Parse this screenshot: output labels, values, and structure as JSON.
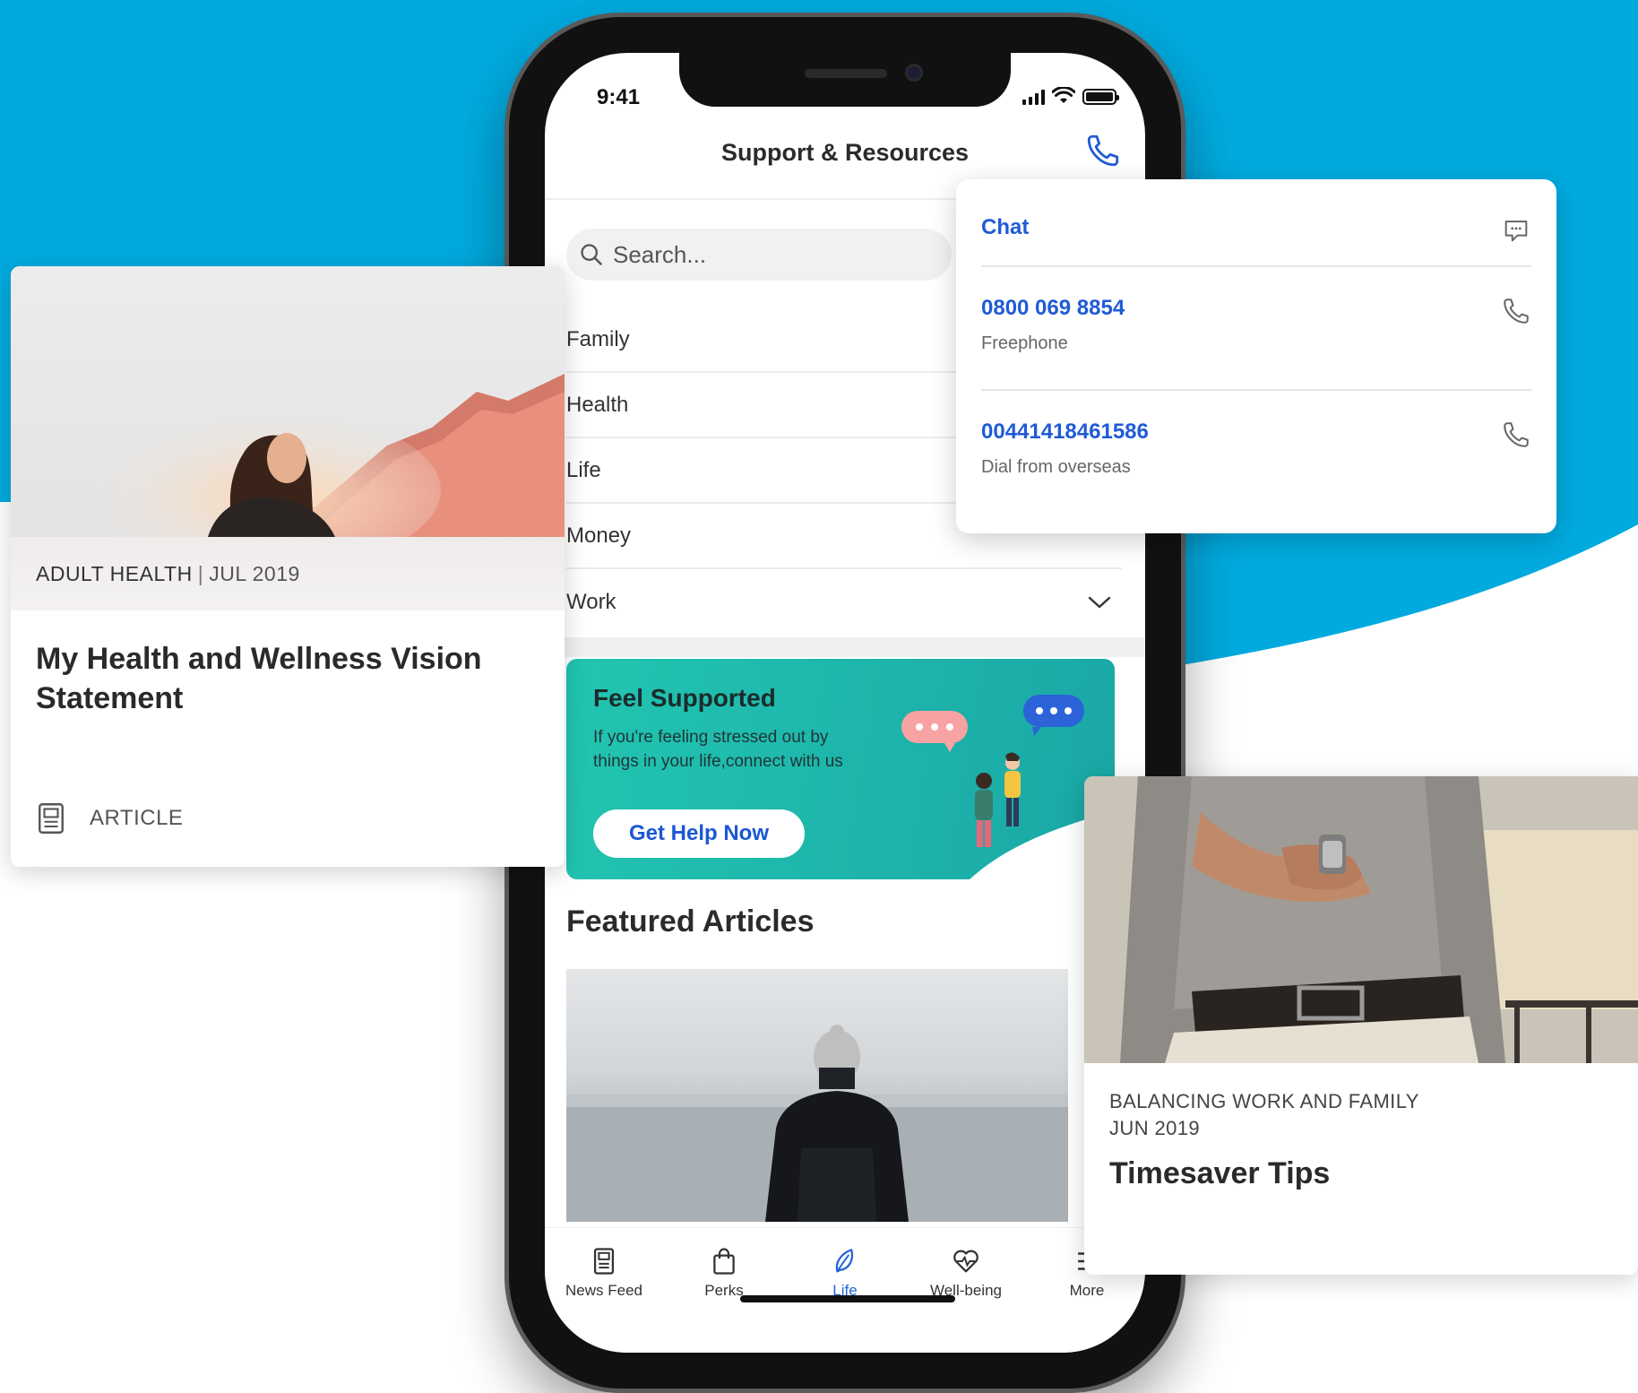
{
  "colors": {
    "brand_blue": "#00aadf",
    "accent_link": "#1f5bd6",
    "banner_teal": "#22c5b1"
  },
  "status_bar": {
    "time": "9:41"
  },
  "header": {
    "title": "Support & Resources"
  },
  "search": {
    "placeholder": "Search..."
  },
  "categories": [
    {
      "label": "Family"
    },
    {
      "label": "Health"
    },
    {
      "label": "Life"
    },
    {
      "label": "Money"
    },
    {
      "label": "Work"
    }
  ],
  "banner": {
    "title": "Feel Supported",
    "text": "If you're feeling stressed out by things in your life,connect with us",
    "button_label": "Get Help Now"
  },
  "featured": {
    "title": "Featured Articles"
  },
  "tabs": [
    {
      "label": "News Feed",
      "icon": "news-icon"
    },
    {
      "label": "Perks",
      "icon": "bag-icon"
    },
    {
      "label": "Life",
      "icon": "leaf-icon",
      "active": true
    },
    {
      "label": "Well-being",
      "icon": "heart-pulse-icon"
    },
    {
      "label": "More",
      "icon": "menu-icon"
    }
  ],
  "contact_popover": {
    "chat": {
      "label": "Chat"
    },
    "freephone": {
      "number": "0800 069 8854",
      "caption": "Freephone"
    },
    "overseas": {
      "number": "00441418461586",
      "caption": "Dial from overseas"
    }
  },
  "article_card_left": {
    "category": "ADULT HEALTH",
    "separator": "|",
    "date": "JUL 2019",
    "title": "My Health and Wellness Vision Statement",
    "type": "ARTICLE"
  },
  "article_card_right": {
    "category": "BALANCING WORK AND FAMILY",
    "date": "JUN 2019",
    "title": "Timesaver Tips"
  }
}
